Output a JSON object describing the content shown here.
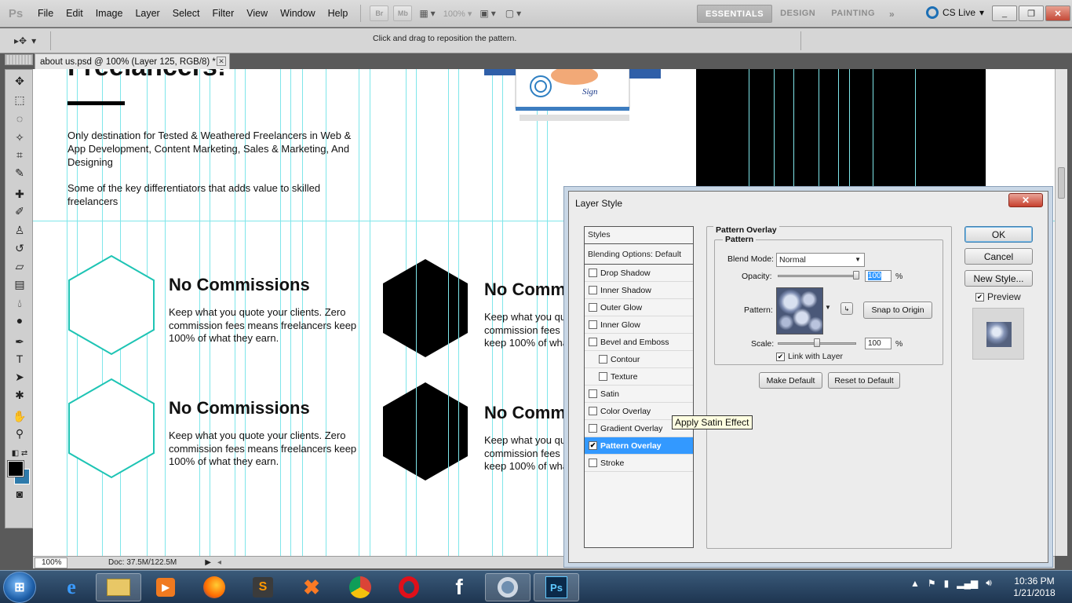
{
  "app": {
    "logo": "Ps",
    "menu": [
      "File",
      "Edit",
      "Image",
      "Layer",
      "Select",
      "Filter",
      "View",
      "Window",
      "Help"
    ],
    "toolbar_small": [
      "Br",
      "Mb"
    ],
    "zoom_level": "100%",
    "workspaces": [
      "ESSENTIALS",
      "DESIGN",
      "PAINTING"
    ],
    "workspace_more": "»",
    "cs_live": "CS Live",
    "window_controls": [
      "_",
      "❐",
      "✕"
    ]
  },
  "options_bar": {
    "message": "Click and drag to reposition the pattern."
  },
  "document": {
    "tab_title": "about us.psd @ 100% (Layer 125, RGB/8) *",
    "tab_close": "✕",
    "status_zoom": "100%",
    "status_doc": "Doc: 37.5M/122.5M"
  },
  "canvas": {
    "heading": "Freelancers!",
    "intro_1": "Only destination for Tested & Weathered Freelancers in Web & App Development, Content Marketing, Sales & Marketing, And Designing",
    "intro_2": "Some of the key differentiators that adds value to skilled freelancers",
    "features": [
      {
        "title": "No Commissions",
        "desc": "Keep what you quote your clients. Zero commission fees means freelancers keep 100% of what they earn."
      },
      {
        "title": "No Comm",
        "desc": "Keep what you qu commission fees keep 100% of wha"
      },
      {
        "title": "No Commissions",
        "desc": "Keep what you quote your clients. Zero commission fees means freelancers keep 100% of what they earn."
      },
      {
        "title": "No Comm",
        "desc": "Keep what you qu commission fees keep 100% of wha"
      }
    ],
    "illustration_text": "Sign"
  },
  "layer_style": {
    "title": "Layer Style",
    "close": "✕",
    "styles_header": "Styles",
    "blending_options": "Blending Options: Default",
    "effects": [
      {
        "label": "Drop Shadow",
        "checked": false,
        "sub": false
      },
      {
        "label": "Inner Shadow",
        "checked": false,
        "sub": false
      },
      {
        "label": "Outer Glow",
        "checked": false,
        "sub": false
      },
      {
        "label": "Inner Glow",
        "checked": false,
        "sub": false
      },
      {
        "label": "Bevel and Emboss",
        "checked": false,
        "sub": false
      },
      {
        "label": "Contour",
        "checked": false,
        "sub": true
      },
      {
        "label": "Texture",
        "checked": false,
        "sub": true
      },
      {
        "label": "Satin",
        "checked": false,
        "sub": false
      },
      {
        "label": "Color Overlay",
        "checked": false,
        "sub": false
      },
      {
        "label": "Gradient Overlay",
        "checked": false,
        "sub": false
      },
      {
        "label": "Pattern Overlay",
        "checked": true,
        "sub": false,
        "selected": true
      },
      {
        "label": "Stroke",
        "checked": false,
        "sub": false
      }
    ],
    "section_title": "Pattern Overlay",
    "group_title": "Pattern",
    "blend_mode_label": "Blend Mode:",
    "blend_mode_value": "Normal",
    "opacity_label": "Opacity:",
    "opacity_value": "100",
    "opacity_fraction": 1.0,
    "percent": "%",
    "pattern_label": "Pattern:",
    "snap_button": "Snap to Origin",
    "scale_label": "Scale:",
    "scale_value": "100",
    "link_label": "Link with Layer",
    "link_checked": true,
    "make_default": "Make Default",
    "reset_default": "Reset to Default",
    "ok": "OK",
    "cancel": "Cancel",
    "new_style": "New Style...",
    "preview_label": "Preview",
    "preview_checked": true,
    "tooltip": "Apply Satin Effect"
  },
  "taskbar": {
    "start": "⊞",
    "time": "10:36 PM",
    "date": "1/21/2018",
    "apps": [
      "ie-icon",
      "explorer-icon",
      "media-player-icon",
      "firefox-icon",
      "sublime-icon",
      "xampp-icon",
      "chrome-icon",
      "opera-icon",
      "facebook-icon",
      "chrome-window-icon",
      "photoshop-icon"
    ]
  },
  "colors": {
    "guide": "#7fe6ea",
    "hex_outline": "#1ec4b4",
    "selection": "#3399ff"
  }
}
